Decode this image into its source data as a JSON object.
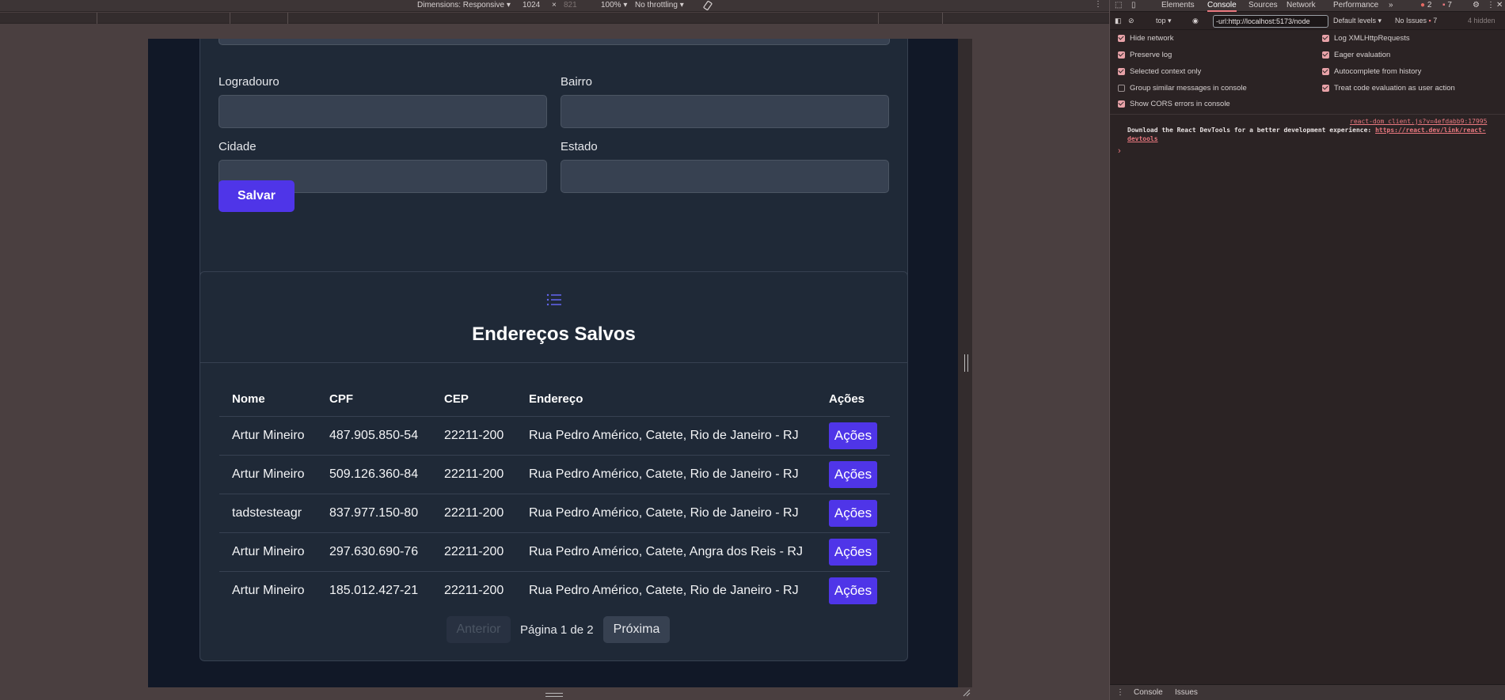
{
  "device_toolbar": {
    "dimensions_label": "Dimensions: Responsive",
    "width": "1024",
    "times": "×",
    "height": "821",
    "zoom": "100%",
    "throttling": "No throttling"
  },
  "form": {
    "logradouro_label": "Logradouro",
    "bairro_label": "Bairro",
    "cidade_label": "Cidade",
    "estado_label": "Estado",
    "save_label": "Salvar"
  },
  "list": {
    "title": "Endereços Salvos",
    "columns": [
      "Nome",
      "CPF",
      "CEP",
      "Endereço",
      "Ações"
    ],
    "rows": [
      {
        "nome": "Artur Mineiro",
        "cpf": "487.905.850-54",
        "cep": "22211-200",
        "endereco": "Rua Pedro Américo, Catete, Rio de Janeiro - RJ",
        "acao": "Ações"
      },
      {
        "nome": "Artur Mineiro",
        "cpf": "509.126.360-84",
        "cep": "22211-200",
        "endereco": "Rua Pedro Américo, Catete, Rio de Janeiro - RJ",
        "acao": "Ações"
      },
      {
        "nome": "tadstesteagr",
        "cpf": "837.977.150-80",
        "cep": "22211-200",
        "endereco": "Rua Pedro Américo, Catete, Rio de Janeiro - RJ",
        "acao": "Ações"
      },
      {
        "nome": "Artur Mineiro",
        "cpf": "297.630.690-76",
        "cep": "22211-200",
        "endereco": "Rua Pedro Américo, Catete, Angra dos Reis - RJ",
        "acao": "Ações"
      },
      {
        "nome": "Artur Mineiro",
        "cpf": "185.012.427-21",
        "cep": "22211-200",
        "endereco": "Rua Pedro Américo, Catete, Rio de Janeiro - RJ",
        "acao": "Ações"
      }
    ],
    "pagination": {
      "prev": "Anterior",
      "info": "Página 1 de 2",
      "next": "Próxima"
    }
  },
  "devtools": {
    "tabs": [
      "Elements",
      "Console",
      "Sources",
      "Network",
      "Performance"
    ],
    "more": "»",
    "error_count": "2",
    "message_count": "7",
    "context": "top",
    "filter_value": "-url:http://localhost:5173/node",
    "levels": "Default levels",
    "issues": "No Issues",
    "issues_count": "7",
    "hidden": "4 hidden",
    "settings_left": [
      {
        "label": "Hide network",
        "checked": true
      },
      {
        "label": "Preserve log",
        "checked": true
      },
      {
        "label": "Selected context only",
        "checked": true
      },
      {
        "label": "Group similar messages in console",
        "checked": false
      },
      {
        "label": "Show CORS errors in console",
        "checked": true
      }
    ],
    "settings_right": [
      {
        "label": "Log XMLHttpRequests",
        "checked": true
      },
      {
        "label": "Eager evaluation",
        "checked": true
      },
      {
        "label": "Autocomplete from history",
        "checked": true
      },
      {
        "label": "Treat code evaluation as user action",
        "checked": true
      }
    ],
    "log_source": "react-dom_client.js?v=4efdabb9:17995",
    "log_message": "Download the React DevTools for a better development experience: ",
    "log_link": "https://react.dev/link/react-devtools",
    "prompt": "›",
    "drawer_tabs": [
      "Console",
      "Issues"
    ]
  },
  "colors": {
    "accent": "#4f35e8",
    "page_bg": "#111827",
    "card_bg": "#1f2937",
    "devtools_accent": "#e9787f"
  }
}
